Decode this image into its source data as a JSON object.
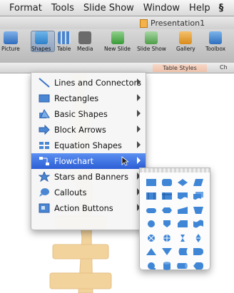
{
  "menubar": {
    "items": [
      "Format",
      "Tools",
      "Slide Show",
      "Window",
      "Help"
    ],
    "script_icon": "§"
  },
  "window": {
    "title": "Presentation1"
  },
  "toolbar": {
    "items": [
      "Picture",
      "Shapes",
      "Table",
      "Media",
      "New Slide",
      "Slide Show",
      "Gallery",
      "Toolbox"
    ]
  },
  "ribbon": {
    "tab_table_styles": "Table Styles",
    "tab_cut": "Ch"
  },
  "shapes_menu": {
    "items": [
      {
        "label": "Lines and Connectors",
        "icon": "line-icon"
      },
      {
        "label": "Rectangles",
        "icon": "rectangle-icon"
      },
      {
        "label": "Basic Shapes",
        "icon": "basic-shapes-icon"
      },
      {
        "label": "Block Arrows",
        "icon": "block-arrow-icon"
      },
      {
        "label": "Equation Shapes",
        "icon": "equation-icon"
      },
      {
        "label": "Flowchart",
        "icon": "flowchart-icon"
      },
      {
        "label": "Stars and Banners",
        "icon": "star-icon"
      },
      {
        "label": "Callouts",
        "icon": "callout-icon"
      },
      {
        "label": "Action Buttons",
        "icon": "action-button-icon"
      }
    ],
    "selected_index": 5
  },
  "flowchart_submenu": {
    "shapes": [
      "process",
      "alternate-process",
      "decision",
      "data",
      "predefined-process",
      "internal-storage",
      "document",
      "multidocument",
      "terminator",
      "preparation",
      "manual-input",
      "manual-operation",
      "connector",
      "off-page-connector",
      "card",
      "punched-tape",
      "summing-junction",
      "or",
      "collate",
      "sort",
      "extract",
      "merge",
      "stored-data",
      "delay",
      "sequential-access-storage",
      "magnetic-disk",
      "direct-access-storage",
      "display"
    ]
  },
  "colors": {
    "accent": "#2c5ed6",
    "shape_blue": "#3f86d6",
    "watermark": "#e8b04a"
  }
}
